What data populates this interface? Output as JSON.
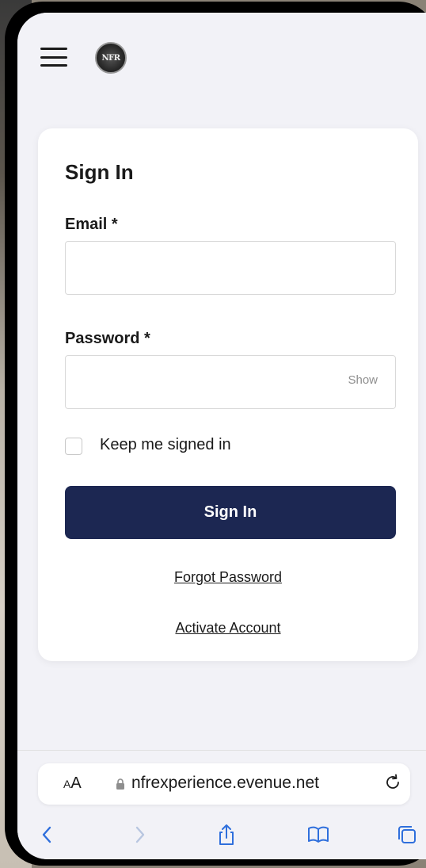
{
  "header": {
    "menu_icon": "hamburger-menu-icon",
    "logo_text": "NFR"
  },
  "signin": {
    "title": "Sign In",
    "email_label": "Email *",
    "email_value": "",
    "password_label": "Password *",
    "password_value": "",
    "show_label": "Show",
    "keep_signed_in_label": "Keep me signed in",
    "keep_signed_in_checked": false,
    "button_label": "Sign In",
    "forgot_password": "Forgot Password",
    "activate_account": "Activate Account"
  },
  "browser": {
    "text_size_label_small": "A",
    "text_size_label_large": "A",
    "url": "nfrexperience.evenue.net",
    "toolbar_icons": [
      "back-icon",
      "forward-icon",
      "share-icon",
      "bookmarks-icon",
      "tabs-icon"
    ]
  },
  "colors": {
    "primary_button": "#1c2752",
    "page_background": "#f2f2f7",
    "card_background": "#ffffff"
  }
}
